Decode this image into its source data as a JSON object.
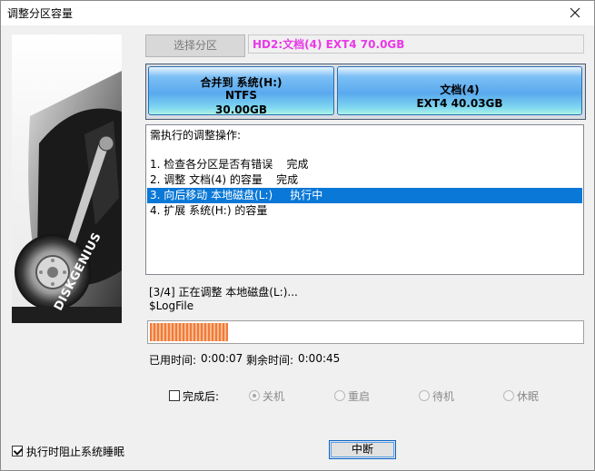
{
  "window": {
    "title": "调整分区容量"
  },
  "brand": {
    "logo_text": "DISKGENIUS"
  },
  "partition_select": {
    "button_label": "选择分区",
    "selected_partition": "HD2:文档(4) EXT4 70.0GB"
  },
  "partition_map": {
    "left": {
      "line1": "合并到 系统(H:)",
      "line2": "NTFS",
      "line3": "30.00GB"
    },
    "right": {
      "line1": "文档(4)",
      "line2": "EXT4 40.03GB"
    }
  },
  "operations": {
    "header": "需执行的调整操作:",
    "items": [
      "1. 检查各分区是否有错误    完成",
      "2. 调整 文档(4) 的容量    完成",
      "3. 向后移动 本地磁盘(L:)     执行中",
      "4. 扩展 系统(H:) 的容量"
    ],
    "selected_index": 2
  },
  "status": {
    "line1": "[3/4] 正在调整 本地磁盘(L:)...",
    "line2": "$LogFile",
    "progress_fraction": 0.18,
    "elapsed_label": "已用时间:",
    "elapsed_value": "0:00:07",
    "remaining_label": "剩余时间:",
    "remaining_value": "0:00:45"
  },
  "after_complete": {
    "label": "完成后:",
    "checked": false,
    "options": [
      "关机",
      "重启",
      "待机",
      "休眠"
    ],
    "selected": "关机"
  },
  "prevent_sleep": {
    "label": "执行时阻止系统睡眠",
    "checked": true
  },
  "actions": {
    "stop_label": "中断"
  },
  "colors": {
    "partition_label": "#e83ae8",
    "selection": "#0a78d7",
    "progress": "#f07a3a",
    "partition_block": "#5aa9ee"
  }
}
